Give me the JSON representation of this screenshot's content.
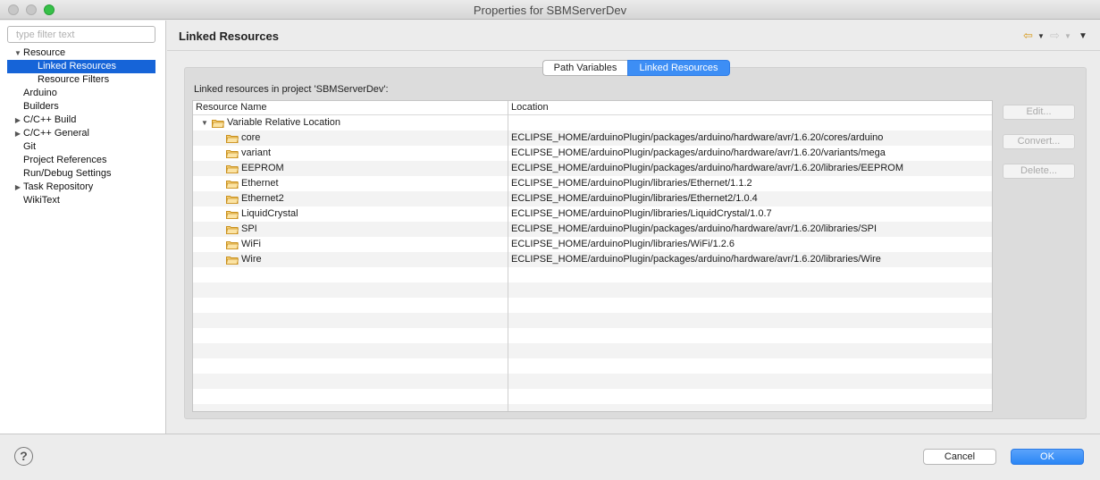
{
  "window": {
    "title": "Properties for SBMServerDev"
  },
  "filter": {
    "placeholder": "type filter text",
    "value": ""
  },
  "tree": [
    {
      "label": "Resource",
      "level": 0,
      "expander": "▼",
      "selected": false
    },
    {
      "label": "Linked Resources",
      "level": 1,
      "expander": "",
      "selected": true
    },
    {
      "label": "Resource Filters",
      "level": 1,
      "expander": "",
      "selected": false
    },
    {
      "label": "Arduino",
      "level": 0,
      "expander": "",
      "selected": false
    },
    {
      "label": "Builders",
      "level": 0,
      "expander": "",
      "selected": false
    },
    {
      "label": "C/C++ Build",
      "level": 0,
      "expander": "▶",
      "selected": false
    },
    {
      "label": "C/C++ General",
      "level": 0,
      "expander": "▶",
      "selected": false
    },
    {
      "label": "Git",
      "level": 0,
      "expander": "",
      "selected": false
    },
    {
      "label": "Project References",
      "level": 0,
      "expander": "",
      "selected": false
    },
    {
      "label": "Run/Debug Settings",
      "level": 0,
      "expander": "",
      "selected": false
    },
    {
      "label": "Task Repository",
      "level": 0,
      "expander": "▶",
      "selected": false
    },
    {
      "label": "WikiText",
      "level": 0,
      "expander": "",
      "selected": false
    }
  ],
  "header": {
    "title": "Linked Resources"
  },
  "tabs": {
    "path_variables": "Path Variables",
    "linked_resources": "Linked Resources"
  },
  "linked_label": "Linked resources in project 'SBMServerDev':",
  "table": {
    "columns": {
      "name": "Resource Name",
      "location": "Location"
    },
    "group": "Variable Relative Location",
    "rows": [
      {
        "name": "core",
        "location": "ECLIPSE_HOME/arduinoPlugin/packages/arduino/hardware/avr/1.6.20/cores/arduino"
      },
      {
        "name": "variant",
        "location": "ECLIPSE_HOME/arduinoPlugin/packages/arduino/hardware/avr/1.6.20/variants/mega"
      },
      {
        "name": "EEPROM",
        "location": "ECLIPSE_HOME/arduinoPlugin/packages/arduino/hardware/avr/1.6.20/libraries/EEPROM"
      },
      {
        "name": "Ethernet",
        "location": "ECLIPSE_HOME/arduinoPlugin/libraries/Ethernet/1.1.2"
      },
      {
        "name": "Ethernet2",
        "location": "ECLIPSE_HOME/arduinoPlugin/libraries/Ethernet2/1.0.4"
      },
      {
        "name": "LiquidCrystal",
        "location": "ECLIPSE_HOME/arduinoPlugin/libraries/LiquidCrystal/1.0.7"
      },
      {
        "name": "SPI",
        "location": "ECLIPSE_HOME/arduinoPlugin/packages/arduino/hardware/avr/1.6.20/libraries/SPI"
      },
      {
        "name": "WiFi",
        "location": "ECLIPSE_HOME/arduinoPlugin/libraries/WiFi/1.2.6"
      },
      {
        "name": "Wire",
        "location": "ECLIPSE_HOME/arduinoPlugin/packages/arduino/hardware/avr/1.6.20/libraries/Wire"
      }
    ]
  },
  "side_buttons": {
    "edit": "Edit...",
    "convert": "Convert...",
    "delete": "Delete..."
  },
  "footer": {
    "help": "?",
    "cancel": "Cancel",
    "ok": "OK"
  },
  "icons": {
    "folder": "folder-icon",
    "back": "back-arrow-icon",
    "forward": "forward-arrow-icon",
    "menu": "view-menu-icon",
    "help": "help-icon"
  },
  "colors": {
    "selection": "#1664d8",
    "accent": "#3d8ef5",
    "folder": "#e8b43c"
  }
}
